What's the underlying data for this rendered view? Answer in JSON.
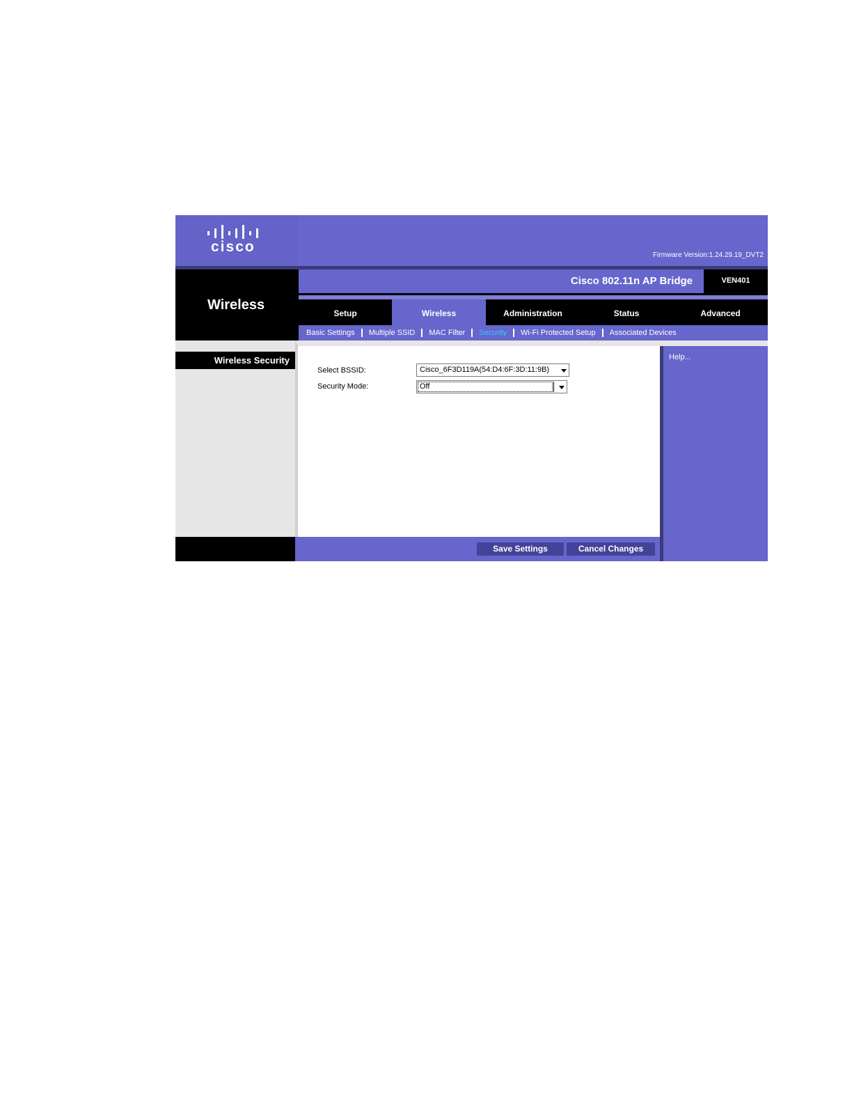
{
  "header": {
    "logo_text": "cisco",
    "firmware": "Firmware Version:1.24.29.19_DVT2",
    "section_title": "Wireless",
    "product_name": "Cisco 802.11n AP Bridge",
    "model": "VEN401"
  },
  "tabs": [
    {
      "label": "Setup",
      "active": false
    },
    {
      "label": "Wireless",
      "active": true
    },
    {
      "label": "Administration",
      "active": false
    },
    {
      "label": "Status",
      "active": false
    },
    {
      "label": "Advanced",
      "active": false
    }
  ],
  "subtabs": [
    {
      "label": "Basic Settings",
      "active": false
    },
    {
      "label": "Multiple SSID",
      "active": false
    },
    {
      "label": "MAC Filter",
      "active": false
    },
    {
      "label": "Security",
      "active": true
    },
    {
      "label": "Wi-Fi Protected Setup",
      "active": false
    },
    {
      "label": "Associated Devices",
      "active": false
    }
  ],
  "sidebar": {
    "label": "Wireless Security"
  },
  "form": {
    "bssid_label": "Select BSSID:",
    "bssid_value": "Cisco_6F3D119A(54:D4:6F:3D:11:9B)",
    "mode_label": "Security Mode:",
    "mode_value": "Off"
  },
  "help": {
    "link": "Help..."
  },
  "buttons": {
    "save": "Save Settings",
    "cancel": "Cancel Changes"
  },
  "colors": {
    "brand": "#6666cc",
    "active_subtab": "#33ccff",
    "button": "#434399"
  }
}
